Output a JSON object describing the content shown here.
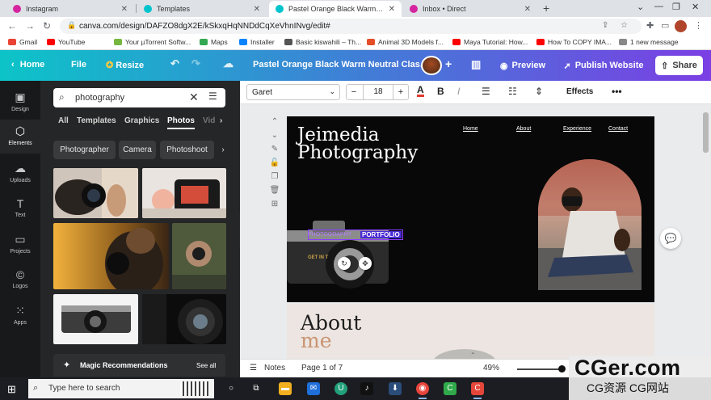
{
  "browser": {
    "tabs": [
      {
        "title": "Instagram",
        "favicon_color": "#d6249f"
      },
      {
        "title": "Templates",
        "favicon_color": "#00c4cc"
      },
      {
        "title": "Pastel Orange Black Warm Neutr",
        "favicon_color": "#00c4cc"
      },
      {
        "title": "Inbox • Direct",
        "favicon_color": "#d6249f"
      }
    ],
    "new_tab": "+",
    "url": "canva.com/design/DAFZO8dgX2E/kSkxqHqNNDdCqXeVhnINvg/edit#",
    "bookmarks": [
      {
        "label": "Gmail",
        "color": "#ea4335"
      },
      {
        "label": "YouTube",
        "color": "#ff0000"
      },
      {
        "label": "Your µTorrent Softw...",
        "color": "#76b83f"
      },
      {
        "label": "Maps",
        "color": "#34a853"
      },
      {
        "label": "Installer",
        "color": "#0a84ff"
      },
      {
        "label": "Basic kiswahili – Th...",
        "color": "#555555"
      },
      {
        "label": "Animal 3D Models f...",
        "color": "#e44d26"
      },
      {
        "label": "Maya Tutorial: How...",
        "color": "#ff0000"
      },
      {
        "label": "How To COPY IMA...",
        "color": "#ff0000"
      },
      {
        "label": "1 new message",
        "color": "#888888"
      }
    ]
  },
  "canva_header": {
    "home": "Home",
    "file": "File",
    "resize": "Resize",
    "doc_title": "Pastel Orange Black Warm Neutral Clas...",
    "preview": "Preview",
    "publish": "Publish Website",
    "share": "Share"
  },
  "rail": [
    {
      "label": "Design",
      "icon": "layout-icon"
    },
    {
      "label": "Elements",
      "icon": "shapes-icon"
    },
    {
      "label": "Uploads",
      "icon": "cloud-upload-icon"
    },
    {
      "label": "Text",
      "icon": "text-icon"
    },
    {
      "label": "Projects",
      "icon": "folder-icon"
    },
    {
      "label": "Logos",
      "icon": "logo-icon"
    },
    {
      "label": "Apps",
      "icon": "apps-grid-icon"
    }
  ],
  "panel": {
    "search_value": "photography",
    "tabs": [
      "All",
      "Templates",
      "Graphics",
      "Photos",
      "Vid"
    ],
    "active_tab": "Photos",
    "chips": [
      "Photographer",
      "Camera",
      "Photoshoot"
    ],
    "magic_title": "Magic Recommendations",
    "see_all": "See all"
  },
  "toolbar": {
    "font": "Garet",
    "size": "18",
    "effects": "Effects",
    "text_color": "#e0382b"
  },
  "canvas": {
    "title_line1": "Jeimedia",
    "title_line2": "Photography",
    "nav": [
      "Home",
      "About",
      "Experience",
      "Contact"
    ],
    "portfolio_a": "PHOTOGRAPHY",
    "portfolio_b": "PORTFOLIO",
    "get_in": "GET IN T",
    "about_line1": "About",
    "about_line2": "me"
  },
  "footer": {
    "notes": "Notes",
    "page": "Page 1 of 7",
    "zoom": "49%"
  },
  "taskbar": {
    "search_placeholder": "Type here to search"
  },
  "watermark": {
    "line1": "CGer.com",
    "line2": "CG资源 CG网站"
  }
}
